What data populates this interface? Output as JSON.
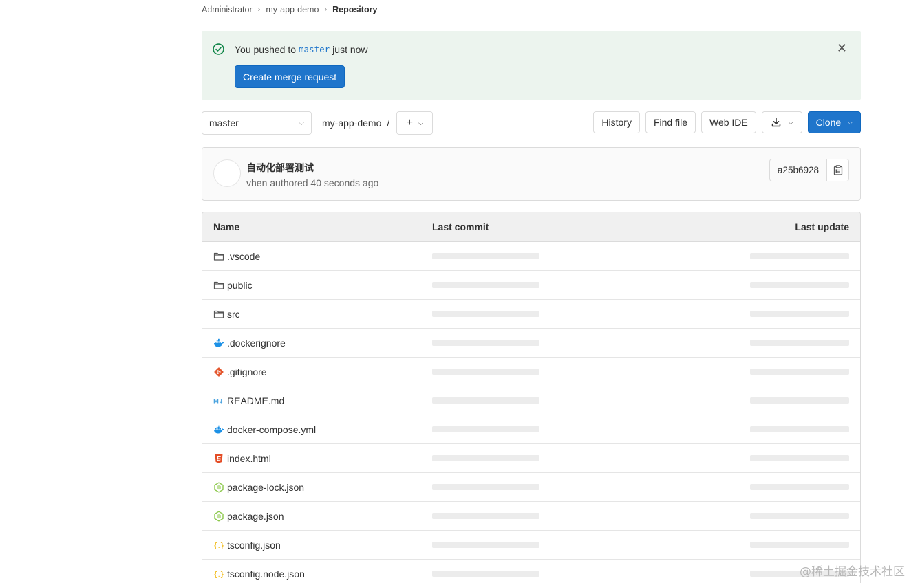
{
  "breadcrumb": [
    "Administrator",
    "my-app-demo",
    "Repository"
  ],
  "alert": {
    "prefix": "You pushed to",
    "branch": "master",
    "suffix": "just now",
    "button_label": "Create merge request",
    "close_symbol": "✕"
  },
  "toolbar": {
    "branch": "master",
    "path": "my-app-demo",
    "path_sep": "/",
    "history_label": "History",
    "find_file_label": "Find file",
    "web_ide_label": "Web IDE",
    "clone_label": "Clone"
  },
  "commit": {
    "title": "自动化部署测试",
    "meta": "vhen authored 40 seconds ago",
    "sha": "a25b6928"
  },
  "table": {
    "headers": {
      "name": "Name",
      "last_commit": "Last commit",
      "last_update": "Last update"
    },
    "files": [
      {
        "name": ".vscode",
        "icon": "folder-icon"
      },
      {
        "name": "public",
        "icon": "folder-icon"
      },
      {
        "name": "src",
        "icon": "folder-icon"
      },
      {
        "name": ".dockerignore",
        "icon": "docker-icon"
      },
      {
        "name": ".gitignore",
        "icon": "git-icon"
      },
      {
        "name": "README.md",
        "icon": "markdown-icon"
      },
      {
        "name": "docker-compose.yml",
        "icon": "docker-icon"
      },
      {
        "name": "index.html",
        "icon": "html5-icon"
      },
      {
        "name": "package-lock.json",
        "icon": "nodejs-icon"
      },
      {
        "name": "package.json",
        "icon": "nodejs-icon"
      },
      {
        "name": "tsconfig.json",
        "icon": "json-icon"
      },
      {
        "name": "tsconfig.node.json",
        "icon": "json-icon"
      }
    ]
  },
  "colors": {
    "primary": "#1f75cb",
    "success_bg": "#ecf4ee",
    "success_icon": "#108548",
    "docker": "#1d91e6",
    "git": "#e4572e",
    "html5": "#e44d26",
    "nodejs": "#8cc84b",
    "json": "#f0b400"
  },
  "watermark": "@稀土掘金技术社区"
}
